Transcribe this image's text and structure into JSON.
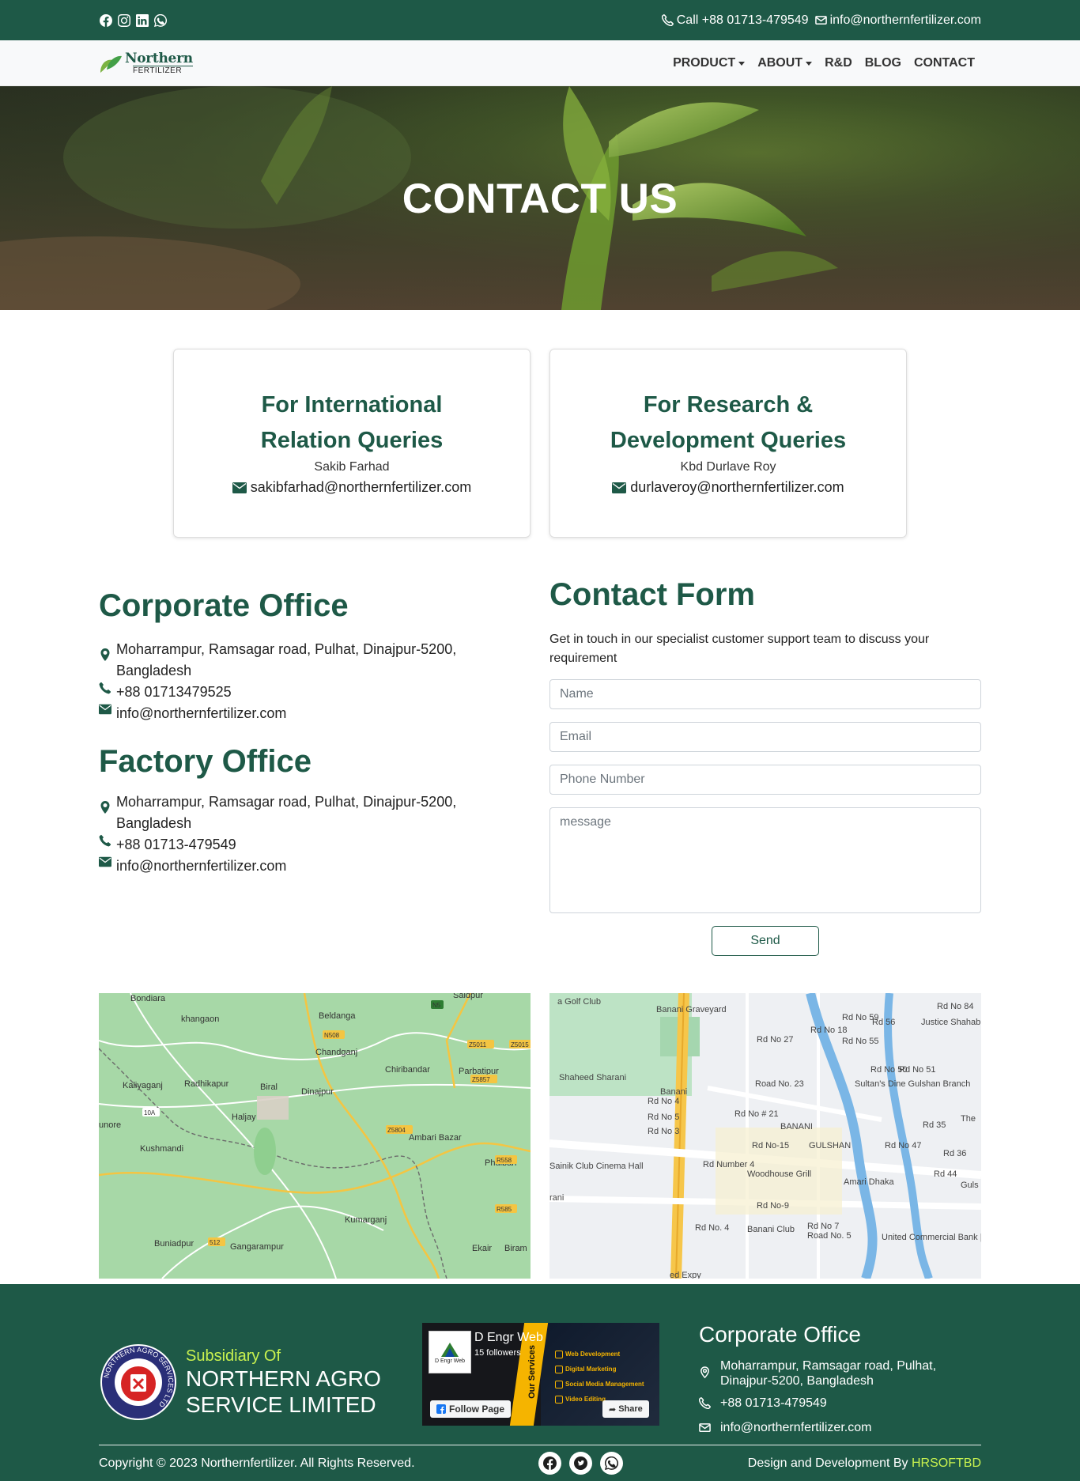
{
  "topbar": {
    "social_icons": [
      "facebook-icon",
      "instagram-icon",
      "linkedin-icon",
      "whatsapp-icon"
    ],
    "phone": "Call +88 01713-479549",
    "email": "info@northernfertilizer.com"
  },
  "brand": {
    "line1": "Northern",
    "line2": "FERTILIZER"
  },
  "nav": {
    "product": "PRODUCT",
    "about": "ABOUT",
    "rnd": "R&D",
    "blog": "BLOG",
    "contact": "CONTACT"
  },
  "hero": {
    "title": "CONTACT US"
  },
  "cards": [
    {
      "title_line1": "For International",
      "title_line2": "Relation Queries",
      "person": "Sakib Farhad",
      "email": "sakibfarhad@northernfertilizer.com"
    },
    {
      "title_line1": "For Research &",
      "title_line2": "Development Queries",
      "person": "Kbd Durlave Roy",
      "email": "durlaveroy@northernfertilizer.com"
    }
  ],
  "corporate": {
    "heading": "Corporate Office",
    "address_line1": "Moharrampur, Ramsagar road, Pulhat, Dinajpur-5200,",
    "address_line2": "Bangladesh",
    "phone": "+88 01713479525",
    "email": "info@northernfertilizer.com"
  },
  "factory": {
    "heading": "Factory Office",
    "address_line1": "Moharrampur, Ramsagar road, Pulhat, Dinajpur-5200,",
    "address_line2": "Bangladesh",
    "phone": "+88 01713-479549",
    "email": "info@northernfertilizer.com"
  },
  "form": {
    "heading": "Contact Form",
    "lead": "Get in touch in our specialist customer support team to discuss your requirement",
    "name_placeholder": "Name",
    "email_placeholder": "Email",
    "phone_placeholder": "Phone Number",
    "message_placeholder": "message",
    "send_label": "Send"
  },
  "map1": {
    "labels": [
      "Bondiara",
      "khangaon",
      "Beldanga",
      "Saidpur",
      "Chandganj",
      "Chiribandar",
      "Parbatipur",
      "Kaliyaganj",
      "Radhikapur",
      "Biral",
      "Dinajpur",
      "Haljay",
      "Ambari Bazar",
      "Kushmandi",
      "Phulbari",
      "Gangarampur",
      "Kumarganj",
      "Buniadpur",
      "Ekair",
      "Biram",
      "unore"
    ],
    "shields": [
      "N5",
      "N508",
      "Z5011",
      "Z5015",
      "Z5857",
      "Z5804",
      "R558",
      "R585",
      "10A",
      "512"
    ]
  },
  "map2": {
    "labels": [
      "a Golf Club",
      "Banani Graveyard",
      "Banani",
      "Rd No 4",
      "Rd No 5",
      "Rd No 3",
      "Rd No # 21",
      "BANANI",
      "Sultan's Dine Gulshan Branch",
      "Justice Shahabuddin Ahmed Park",
      "Sainik Club Cinema Hall",
      "Woodhouse Grill",
      "Amari Dhaka",
      "Banani Club",
      "United Commercial Bank | Head Office",
      "Road No. 23",
      "Rd No 27",
      "Rd No-15",
      "Rd No-9",
      "Rd No 7",
      "Road No. 5",
      "GULSHAN",
      "Rd No 47",
      "Rd No 59",
      "Rd No 55",
      "Rd No 84",
      "Rd 56",
      "Rd No 50",
      "Rd No 51",
      "Rd 35",
      "Rd 36",
      "Rd 44",
      "rani",
      "ed Expy",
      "Shaheed Sharani",
      "Rd Number 4",
      "Rd No. 4",
      "Rd No 18",
      "The",
      "Guls"
    ]
  },
  "footer": {
    "subsidiary": "Subsidiary Of",
    "company_line1": "NORTHERN AGRO",
    "company_line2": "SERVICE LIMITED",
    "seal_text": "NORTHERN AGRO SERVICES LTD",
    "fb_title": "D Engr Web",
    "fb_followers": "15 followers",
    "fb_follow": "Follow Page",
    "fb_share": "Share",
    "fb_logo_caption": "D Engr Web",
    "fb_services_label": "Our Services",
    "fb_services": [
      "Web Development",
      "Digital Marketing",
      "Social Media Management",
      "Video Editing"
    ],
    "office_heading": "Corporate Office",
    "office_address": "Moharrampur, Ramsagar road, Pulhat, Dinajpur-5200, Bangladesh",
    "office_phone": "+88 01713-479549",
    "office_email": "info@northernfertilizer.com",
    "copyright": "Copyright © 2023 Northernfertilizer. All Rights Reserved.",
    "credit_prefix": "Design and Development By",
    "credit_link": "HRSOFTBD"
  },
  "colors": {
    "brand_green": "#1e5947",
    "accent_lime": "#c9f24f"
  }
}
